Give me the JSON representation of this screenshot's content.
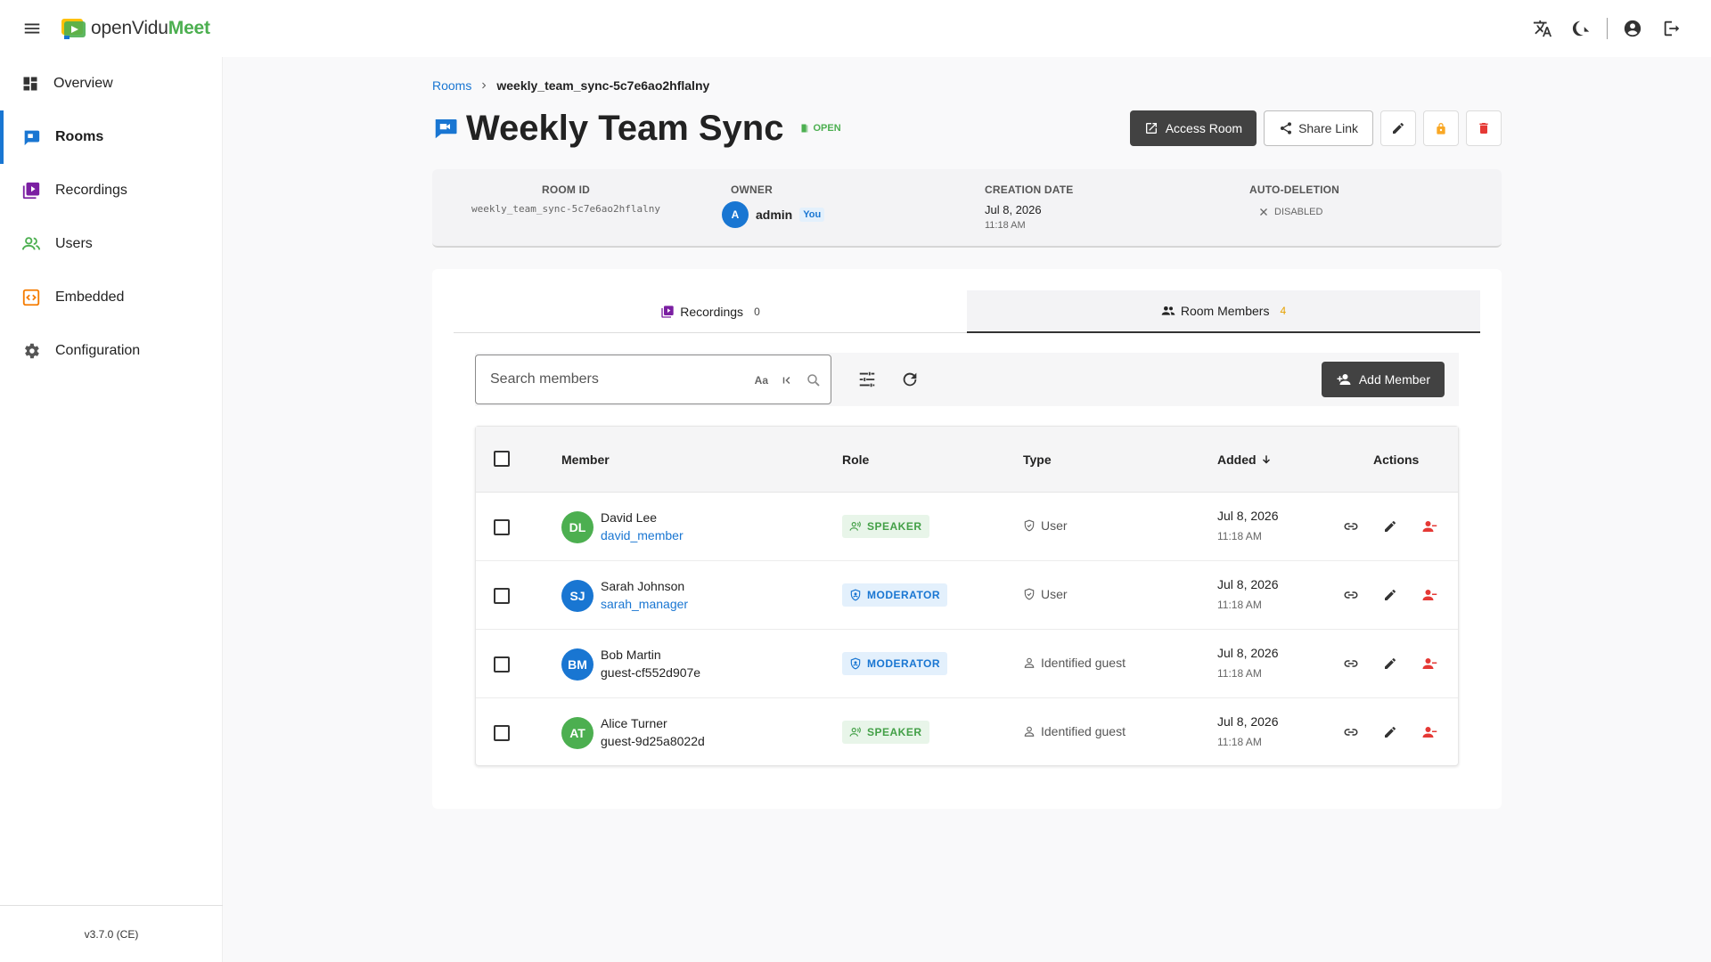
{
  "header": {
    "logo_text": "openVidu",
    "logo_accent": "Meet",
    "icons": [
      "translate-icon",
      "theme-toggle-icon",
      "account-icon",
      "logout-icon"
    ]
  },
  "sidebar": {
    "items": [
      {
        "label": "Overview",
        "icon": "dashboard-icon"
      },
      {
        "label": "Rooms",
        "icon": "rooms-icon",
        "active": true
      },
      {
        "label": "Recordings",
        "icon": "recordings-icon"
      },
      {
        "label": "Users",
        "icon": "users-icon"
      },
      {
        "label": "Embedded",
        "icon": "embedded-icon"
      },
      {
        "label": "Configuration",
        "icon": "gear-icon"
      }
    ],
    "version": "v3.7.0 (CE)"
  },
  "breadcrumb": {
    "root": "Rooms",
    "current": "weekly_team_sync-5c7e6ao2hflalny"
  },
  "room": {
    "title": "Weekly Team Sync",
    "status": "OPEN",
    "actions": {
      "access": "Access Room",
      "share": "Share Link"
    }
  },
  "info": {
    "room_id_label": "ROOM ID",
    "room_id": "weekly_team_sync-5c7e6ao2hflalny",
    "owner_label": "OWNER",
    "owner_initial": "A",
    "owner_name": "admin",
    "owner_you": "You",
    "creation_label": "CREATION DATE",
    "creation_date": "Jul 8, 2026",
    "creation_time": "11:18 AM",
    "autodel_label": "AUTO-DELETION",
    "autodel_value": "DISABLED"
  },
  "tabs": [
    {
      "label": "Recordings",
      "count": "0"
    },
    {
      "label": "Room Members",
      "count": "4",
      "active": true
    }
  ],
  "search": {
    "placeholder": "Search members",
    "case_toggle": "Aa"
  },
  "add_member_label": "Add Member",
  "table": {
    "headers": {
      "member": "Member",
      "role": "Role",
      "type": "Type",
      "added": "Added",
      "actions": "Actions"
    },
    "rows": [
      {
        "initials": "DL",
        "avatar_color": "#4caf50",
        "name": "David Lee",
        "username": "david_member",
        "username_link": true,
        "role": "SPEAKER",
        "type": "User",
        "date": "Jul 8, 2026",
        "time": "11:18 AM"
      },
      {
        "initials": "SJ",
        "avatar_color": "#1976d2",
        "name": "Sarah Johnson",
        "username": "sarah_manager",
        "username_link": true,
        "role": "MODERATOR",
        "type": "User",
        "date": "Jul 8, 2026",
        "time": "11:18 AM"
      },
      {
        "initials": "BM",
        "avatar_color": "#1976d2",
        "name": "Bob Martin",
        "username": "guest-cf552d907e",
        "username_link": false,
        "role": "MODERATOR",
        "type": "Identified guest",
        "date": "Jul 8, 2026",
        "time": "11:18 AM"
      },
      {
        "initials": "AT",
        "avatar_color": "#4caf50",
        "name": "Alice Turner",
        "username": "guest-9d25a8022d",
        "username_link": false,
        "role": "SPEAKER",
        "type": "Identified guest",
        "date": "Jul 8, 2026",
        "time": "11:18 AM"
      }
    ]
  },
  "colors": {
    "accent": "#1976d2",
    "success": "#4caf50",
    "danger": "#e53935",
    "warning": "#f9a825",
    "dark_button": "#424242"
  }
}
